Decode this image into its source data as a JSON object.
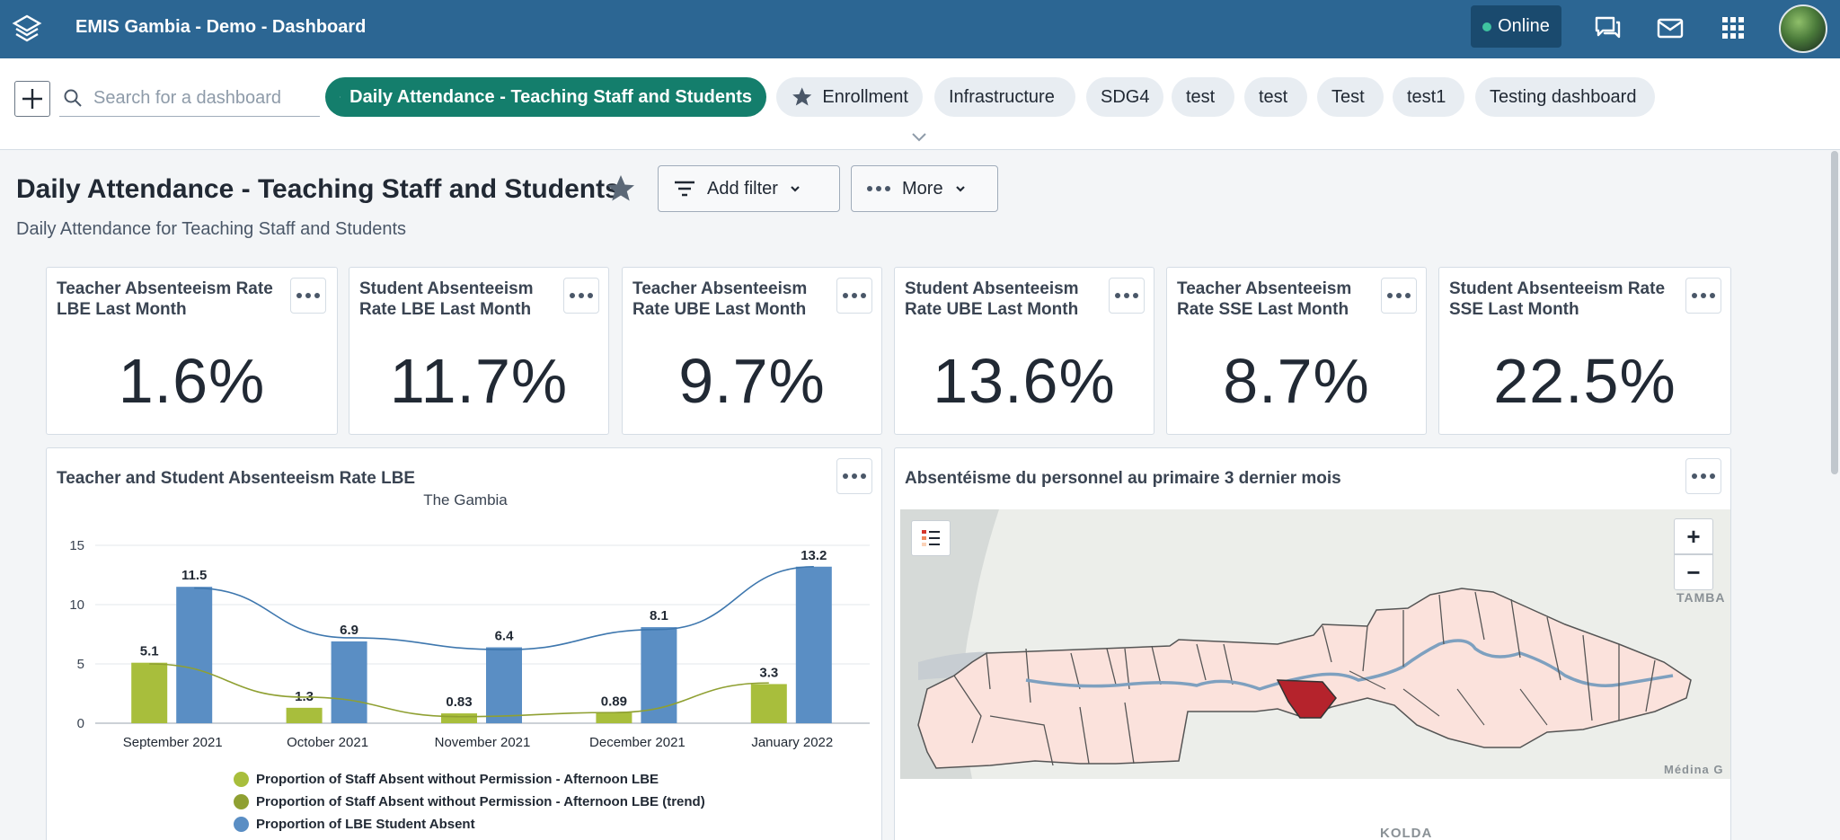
{
  "header": {
    "title": "EMIS Gambia - Demo - Dashboard",
    "online_label": "Online",
    "icons": [
      "apps-logo-icon",
      "interpretations-icon",
      "messages-icon",
      "apps-grid-icon",
      "profile-avatar"
    ]
  },
  "controlbar": {
    "search_placeholder": "Search for a dashboard",
    "chips": [
      {
        "label": "Daily Attendance - Teaching Staff and Students",
        "active": true,
        "starred": true
      },
      {
        "label": "Enrollment",
        "active": false,
        "starred": true
      },
      {
        "label": "Infrastructure",
        "active": false,
        "starred": false
      },
      {
        "label": "SDG4",
        "active": false,
        "starred": false
      },
      {
        "label": "test",
        "active": false,
        "starred": false
      },
      {
        "label": "test",
        "active": false,
        "starred": false
      },
      {
        "label": "Test",
        "active": false,
        "starred": false
      },
      {
        "label": "test1",
        "active": false,
        "starred": false
      },
      {
        "label": "Testing dashboard",
        "active": false,
        "starred": false
      }
    ]
  },
  "dashboard": {
    "title": "Daily Attendance - Teaching Staff and Students",
    "description": "Daily Attendance for Teaching Staff and Students",
    "add_filter_label": "Add filter",
    "more_label": "More"
  },
  "kpis": [
    {
      "title": "Teacher Absenteeism Rate LBE Last Month",
      "value": "1.6%"
    },
    {
      "title": "Student Absenteeism Rate LBE Last Month",
      "value": "11.7%"
    },
    {
      "title": "Teacher Absenteeism Rate UBE Last Month",
      "value": "9.7%"
    },
    {
      "title": "Student Absenteeism Rate UBE Last Month",
      "value": "13.6%"
    },
    {
      "title": "Teacher Absenteeism Rate SSE Last Month",
      "value": "8.7%"
    },
    {
      "title": "Student Absenteeism Rate SSE Last Month",
      "value": "22.5%"
    }
  ],
  "chart_card": {
    "title": "Teacher and Student Absenteeism Rate LBE"
  },
  "map_card": {
    "title": "Absentéisme du personnel au primaire 3 dernier mois",
    "labels": {
      "tamba": "TAMBA",
      "medina": "Médina G",
      "kolda": "KOLDA"
    },
    "zoom_in": "+",
    "zoom_out": "−"
  },
  "chart_data": {
    "type": "bar",
    "title": "The Gambia",
    "categories": [
      "September 2021",
      "October 2021",
      "November 2021",
      "December 2021",
      "January 2022"
    ],
    "ylim": [
      0,
      15
    ],
    "yticks": [
      0,
      5,
      10,
      15
    ],
    "grid": true,
    "legend_position": "bottom",
    "series": [
      {
        "name": "Proportion of Staff Absent without Permission - Afternoon LBE",
        "values": [
          5.1,
          1.3,
          0.83,
          0.89,
          3.3
        ],
        "color": "#a8be3c",
        "kind": "bar"
      },
      {
        "name": "Proportion of Staff Absent without Permission - Afternoon LBE (trend)",
        "values": [
          5.0,
          2.2,
          0.55,
          0.9,
          3.4
        ],
        "color": "#8fa032",
        "kind": "trend"
      },
      {
        "name": "Proportion of LBE Student Absent",
        "values": [
          11.5,
          6.9,
          6.4,
          8.1,
          13.2
        ],
        "color": "#5a8ec4",
        "kind": "bar"
      }
    ],
    "trend_lines": [
      {
        "series": "Proportion of LBE Student Absent",
        "color": "#3e77ae",
        "values": [
          11.4,
          7.2,
          6.2,
          7.9,
          13.2
        ]
      }
    ]
  }
}
